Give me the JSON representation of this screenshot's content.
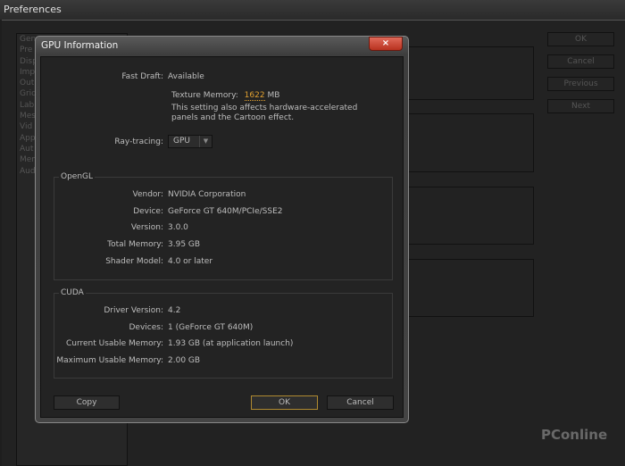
{
  "preferences": {
    "title": "Preferences",
    "sidebar": [
      "Gen",
      "Pre",
      "Disp",
      "Imp",
      "Out",
      "Grid",
      "Lab",
      "Mes",
      "Vid",
      "App",
      "Aut",
      "Mem",
      "Aud"
    ],
    "buttons": {
      "ok": "OK",
      "cancel": "Cancel",
      "previous": "Previous",
      "next": "Next"
    }
  },
  "dialog": {
    "title": "GPU Information",
    "close": "×",
    "fast_draft_label": "Fast Draft:",
    "fast_draft_value": "Available",
    "texture_memory_label": "Texture Memory:",
    "texture_memory_value": "1622",
    "texture_memory_unit": "MB",
    "texture_memory_color": "#e0a030",
    "note_line1": "This setting also affects hardware-accelerated",
    "note_line2": "panels and the Cartoon effect.",
    "ray_tracing_label": "Ray-tracing:",
    "ray_tracing_value": "GPU",
    "opengl": {
      "title": "OpenGL",
      "rows": [
        [
          "Vendor:",
          "NVIDIA Corporation"
        ],
        [
          "Device:",
          "GeForce GT 640M/PCIe/SSE2"
        ],
        [
          "Version:",
          "3.0.0"
        ],
        [
          "Total Memory:",
          "3.95 GB"
        ],
        [
          "Shader Model:",
          "4.0 or later"
        ]
      ]
    },
    "cuda": {
      "title": "CUDA",
      "rows": [
        [
          "Driver Version:",
          "4.2"
        ],
        [
          "Devices:",
          "1 (GeForce GT 640M)"
        ],
        [
          "Current Usable Memory:",
          "1.93 GB (at application launch)"
        ],
        [
          "Maximum Usable Memory:",
          "2.00 GB"
        ]
      ]
    },
    "copy": "Copy",
    "ok": "OK",
    "cancel": "Cancel"
  },
  "watermark": "PConline"
}
